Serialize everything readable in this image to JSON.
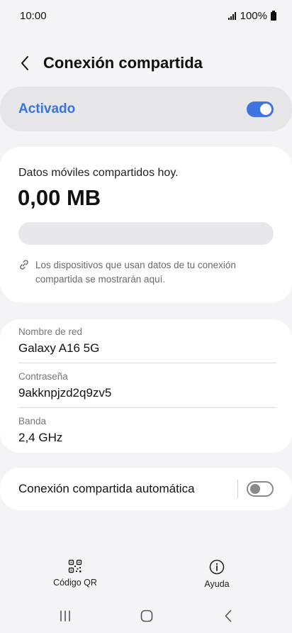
{
  "status_bar": {
    "time": "10:00",
    "battery": "100%"
  },
  "header": {
    "title": "Conexión compartida"
  },
  "master_switch": {
    "label": "Activado",
    "enabled": true,
    "accent": "#3e74e0"
  },
  "usage": {
    "label": "Datos móviles compartidos hoy.",
    "value": "0,00 MB",
    "progress": 0,
    "note": "Los dispositivos que usan datos de tu conexión compartida se mostrarán aquí."
  },
  "network": {
    "rows": [
      {
        "label": "Nombre de red",
        "value": "Galaxy A16 5G"
      },
      {
        "label": "Contraseña",
        "value": "9akknpjzd2q9zv5"
      },
      {
        "label": "Banda",
        "value": "2,4 GHz"
      }
    ]
  },
  "auto_hotspot": {
    "label": "Conexión compartida automática",
    "enabled": false
  },
  "bottom_actions": {
    "qr_label": "Código QR",
    "help_label": "Ayuda"
  },
  "icons": {
    "back": "chevron-left-icon",
    "link": "link-icon",
    "qr": "qr-code-icon",
    "help": "info-icon",
    "recents": "recents-icon",
    "home": "home-icon",
    "nav_back": "nav-back-icon"
  }
}
